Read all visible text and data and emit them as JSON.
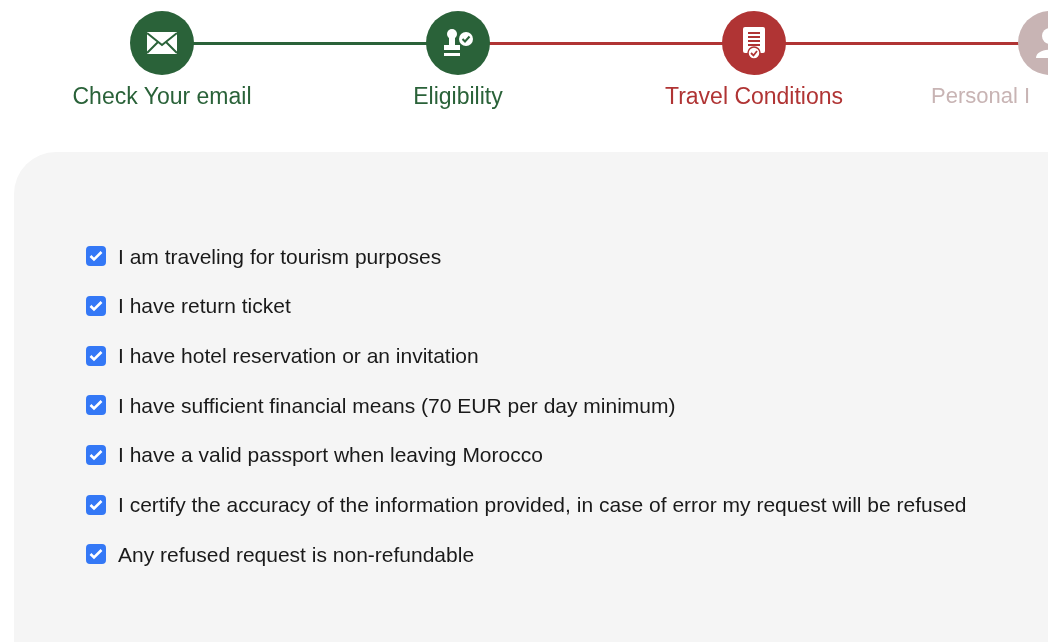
{
  "steps": [
    {
      "label": "Check Your email",
      "completed": true,
      "selected": false
    },
    {
      "label": "Eligibility",
      "completed": true,
      "selected": false
    },
    {
      "label": "Travel Conditions",
      "completed": false,
      "selected": true
    },
    {
      "label": "Personal I",
      "completed": false,
      "selected": false
    }
  ],
  "conditions": [
    {
      "label": "I am traveling for tourism purposes",
      "checked": true
    },
    {
      "label": "I have return ticket",
      "checked": true
    },
    {
      "label": "I have hotel reservation or an invitation",
      "checked": true
    },
    {
      "label": "I have sufficient financial means (70 EUR per day minimum)",
      "checked": true
    },
    {
      "label": "I have a valid passport when leaving Morocco",
      "checked": true
    },
    {
      "label": "I certify the accuracy of the information provided, in case of error my request will be refused",
      "checked": true
    },
    {
      "label": "Any refused request is non-refundable",
      "checked": true
    }
  ]
}
